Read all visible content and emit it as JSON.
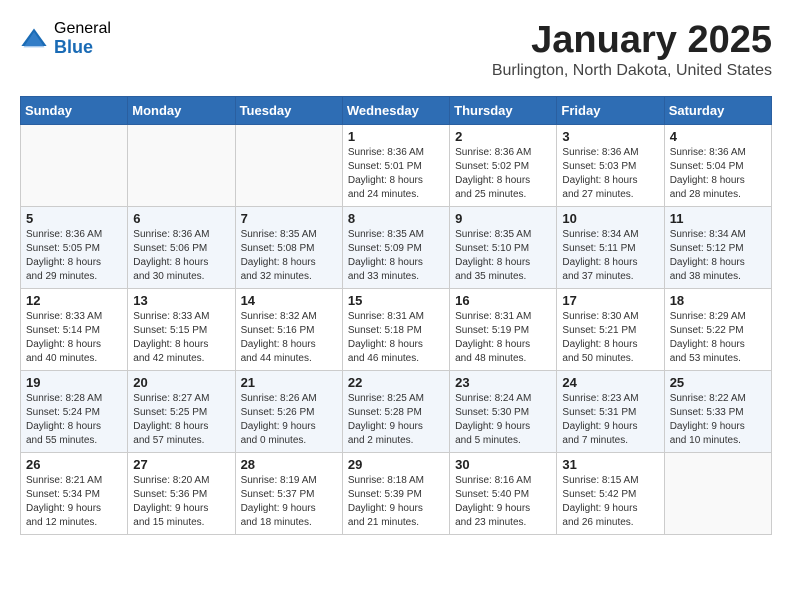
{
  "header": {
    "logo_general": "General",
    "logo_blue": "Blue",
    "month": "January 2025",
    "location": "Burlington, North Dakota, United States"
  },
  "weekdays": [
    "Sunday",
    "Monday",
    "Tuesday",
    "Wednesday",
    "Thursday",
    "Friday",
    "Saturday"
  ],
  "weeks": [
    [
      {
        "day": "",
        "content": ""
      },
      {
        "day": "",
        "content": ""
      },
      {
        "day": "",
        "content": ""
      },
      {
        "day": "1",
        "content": "Sunrise: 8:36 AM\nSunset: 5:01 PM\nDaylight: 8 hours\nand 24 minutes."
      },
      {
        "day": "2",
        "content": "Sunrise: 8:36 AM\nSunset: 5:02 PM\nDaylight: 8 hours\nand 25 minutes."
      },
      {
        "day": "3",
        "content": "Sunrise: 8:36 AM\nSunset: 5:03 PM\nDaylight: 8 hours\nand 27 minutes."
      },
      {
        "day": "4",
        "content": "Sunrise: 8:36 AM\nSunset: 5:04 PM\nDaylight: 8 hours\nand 28 minutes."
      }
    ],
    [
      {
        "day": "5",
        "content": "Sunrise: 8:36 AM\nSunset: 5:05 PM\nDaylight: 8 hours\nand 29 minutes."
      },
      {
        "day": "6",
        "content": "Sunrise: 8:36 AM\nSunset: 5:06 PM\nDaylight: 8 hours\nand 30 minutes."
      },
      {
        "day": "7",
        "content": "Sunrise: 8:35 AM\nSunset: 5:08 PM\nDaylight: 8 hours\nand 32 minutes."
      },
      {
        "day": "8",
        "content": "Sunrise: 8:35 AM\nSunset: 5:09 PM\nDaylight: 8 hours\nand 33 minutes."
      },
      {
        "day": "9",
        "content": "Sunrise: 8:35 AM\nSunset: 5:10 PM\nDaylight: 8 hours\nand 35 minutes."
      },
      {
        "day": "10",
        "content": "Sunrise: 8:34 AM\nSunset: 5:11 PM\nDaylight: 8 hours\nand 37 minutes."
      },
      {
        "day": "11",
        "content": "Sunrise: 8:34 AM\nSunset: 5:12 PM\nDaylight: 8 hours\nand 38 minutes."
      }
    ],
    [
      {
        "day": "12",
        "content": "Sunrise: 8:33 AM\nSunset: 5:14 PM\nDaylight: 8 hours\nand 40 minutes."
      },
      {
        "day": "13",
        "content": "Sunrise: 8:33 AM\nSunset: 5:15 PM\nDaylight: 8 hours\nand 42 minutes."
      },
      {
        "day": "14",
        "content": "Sunrise: 8:32 AM\nSunset: 5:16 PM\nDaylight: 8 hours\nand 44 minutes."
      },
      {
        "day": "15",
        "content": "Sunrise: 8:31 AM\nSunset: 5:18 PM\nDaylight: 8 hours\nand 46 minutes."
      },
      {
        "day": "16",
        "content": "Sunrise: 8:31 AM\nSunset: 5:19 PM\nDaylight: 8 hours\nand 48 minutes."
      },
      {
        "day": "17",
        "content": "Sunrise: 8:30 AM\nSunset: 5:21 PM\nDaylight: 8 hours\nand 50 minutes."
      },
      {
        "day": "18",
        "content": "Sunrise: 8:29 AM\nSunset: 5:22 PM\nDaylight: 8 hours\nand 53 minutes."
      }
    ],
    [
      {
        "day": "19",
        "content": "Sunrise: 8:28 AM\nSunset: 5:24 PM\nDaylight: 8 hours\nand 55 minutes."
      },
      {
        "day": "20",
        "content": "Sunrise: 8:27 AM\nSunset: 5:25 PM\nDaylight: 8 hours\nand 57 minutes."
      },
      {
        "day": "21",
        "content": "Sunrise: 8:26 AM\nSunset: 5:26 PM\nDaylight: 9 hours\nand 0 minutes."
      },
      {
        "day": "22",
        "content": "Sunrise: 8:25 AM\nSunset: 5:28 PM\nDaylight: 9 hours\nand 2 minutes."
      },
      {
        "day": "23",
        "content": "Sunrise: 8:24 AM\nSunset: 5:30 PM\nDaylight: 9 hours\nand 5 minutes."
      },
      {
        "day": "24",
        "content": "Sunrise: 8:23 AM\nSunset: 5:31 PM\nDaylight: 9 hours\nand 7 minutes."
      },
      {
        "day": "25",
        "content": "Sunrise: 8:22 AM\nSunset: 5:33 PM\nDaylight: 9 hours\nand 10 minutes."
      }
    ],
    [
      {
        "day": "26",
        "content": "Sunrise: 8:21 AM\nSunset: 5:34 PM\nDaylight: 9 hours\nand 12 minutes."
      },
      {
        "day": "27",
        "content": "Sunrise: 8:20 AM\nSunset: 5:36 PM\nDaylight: 9 hours\nand 15 minutes."
      },
      {
        "day": "28",
        "content": "Sunrise: 8:19 AM\nSunset: 5:37 PM\nDaylight: 9 hours\nand 18 minutes."
      },
      {
        "day": "29",
        "content": "Sunrise: 8:18 AM\nSunset: 5:39 PM\nDaylight: 9 hours\nand 21 minutes."
      },
      {
        "day": "30",
        "content": "Sunrise: 8:16 AM\nSunset: 5:40 PM\nDaylight: 9 hours\nand 23 minutes."
      },
      {
        "day": "31",
        "content": "Sunrise: 8:15 AM\nSunset: 5:42 PM\nDaylight: 9 hours\nand 26 minutes."
      },
      {
        "day": "",
        "content": ""
      }
    ]
  ]
}
